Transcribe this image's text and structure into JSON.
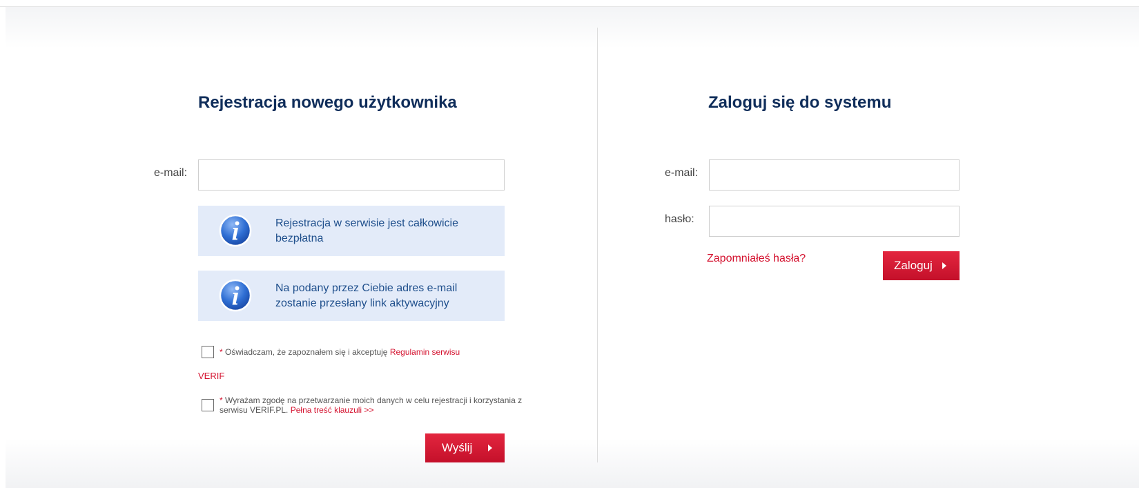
{
  "register": {
    "title": "Rejestracja nowego użytkownika",
    "email_label": "e-mail:",
    "email_value": "",
    "info": [
      "Rejestracja w serwisie jest całkowicie bezpłatna",
      "Na podany przez Ciebie adres e-mail zostanie przesłany link aktywacyjny"
    ],
    "terms": {
      "required_mark": "*",
      "text": "Oświadczam, że zapoznałem się i akceptuję",
      "link": "Regulamin serwisu",
      "link_cont": "VERIF"
    },
    "consent": {
      "required_mark": "*",
      "text": "Wyrażam zgodę na przetwarzanie moich danych w celu rejestracji i korzystania z serwisu VERIF.PL.",
      "link": "Pełna treść klauzuli >>"
    },
    "submit_label": "Wyślij"
  },
  "login": {
    "title": "Zaloguj się do systemu",
    "email_label": "e-mail:",
    "email_value": "",
    "password_label": "hasło:",
    "password_value": "",
    "forgot_label": "Zapomniałeś hasła?",
    "submit_label": "Zaloguj"
  },
  "colors": {
    "heading": "#0f2d5a",
    "accent_red": "#d4112e",
    "info_bg": "#e3ebf9",
    "info_text": "#1f4f8c"
  },
  "icons": {
    "info": "info-icon",
    "submit_arrow": "caret-right-icon"
  }
}
